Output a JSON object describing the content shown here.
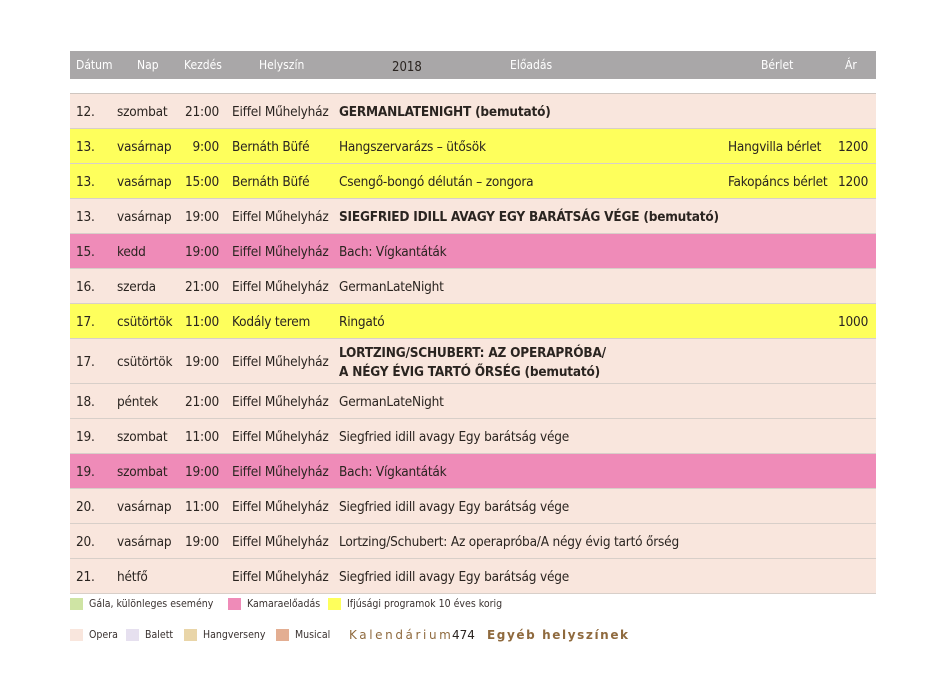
{
  "header": {
    "date": "Dátum",
    "day": "Nap",
    "start": "Kezdés",
    "venue": "Helyszín",
    "year": "2018",
    "show": "Előadás",
    "pass": "Bérlet",
    "price": "Ár"
  },
  "rows": [
    {
      "date": "12.",
      "day": "szombat",
      "time": "21:00",
      "venue": "Eiffel Műhelyház",
      "show": "GERMANLATENIGHT (bemutató)",
      "bold": true,
      "pass": "",
      "price": "",
      "category": "opera"
    },
    {
      "date": "13.",
      "day": "vasárnap",
      "time": "9:00",
      "venue": "Bernáth Büfé",
      "show": "Hangszervarázs – ütősök",
      "bold": false,
      "pass": "Hangvilla bérlet",
      "price": "1200",
      "category": "youth"
    },
    {
      "date": "13.",
      "day": "vasárnap",
      "time": "15:00",
      "venue": "Bernáth Büfé",
      "show": "Csengő-bongó délután – zongora",
      "bold": false,
      "pass": "Fakopáncs bérlet",
      "price": "1200",
      "category": "youth"
    },
    {
      "date": "13.",
      "day": "vasárnap",
      "time": "19:00",
      "venue": "Eiffel Műhelyház",
      "show": "SIEGFRIED IDILL AVAGY EGY BARÁTSÁG VÉGE (bemutató)",
      "bold": true,
      "pass": "",
      "price": "",
      "category": "opera"
    },
    {
      "date": "15.",
      "day": "kedd",
      "time": "19:00",
      "venue": "Eiffel Műhelyház",
      "show": "Bach: Vígkantáták",
      "bold": false,
      "pass": "",
      "price": "",
      "category": "chamber"
    },
    {
      "date": "16.",
      "day": "szerda",
      "time": "21:00",
      "venue": "Eiffel Műhelyház",
      "show": "GermanLateNight",
      "bold": false,
      "pass": "",
      "price": "",
      "category": "opera"
    },
    {
      "date": "17.",
      "day": "csütörtök",
      "time": "11:00",
      "venue": "Kodály terem",
      "show": "Ringató",
      "bold": false,
      "pass": "",
      "price": "1000",
      "category": "youth"
    },
    {
      "date": "17.",
      "day": "csütörtök",
      "time": "19:00",
      "venue": "Eiffel Műhelyház",
      "show": "LORTZING/SCHUBERT: AZ OPERAPRÓBA/\nA NÉGY ÉVIG TARTÓ ŐRSÉG (bemutató)",
      "bold": true,
      "pass": "",
      "price": "",
      "category": "opera",
      "tall": true
    },
    {
      "date": "18.",
      "day": "péntek",
      "time": "21:00",
      "venue": "Eiffel Műhelyház",
      "show": "GermanLateNight",
      "bold": false,
      "pass": "",
      "price": "",
      "category": "opera"
    },
    {
      "date": "19.",
      "day": "szombat",
      "time": "11:00",
      "venue": "Eiffel Műhelyház",
      "show": "Siegfried idill avagy Egy barátság vége",
      "bold": false,
      "pass": "",
      "price": "",
      "category": "opera"
    },
    {
      "date": "19.",
      "day": "szombat",
      "time": "19:00",
      "venue": "Eiffel Műhelyház",
      "show": "Bach: Vígkantáták",
      "bold": false,
      "pass": "",
      "price": "",
      "category": "chamber"
    },
    {
      "date": "20.",
      "day": "vasárnap",
      "time": "11:00",
      "venue": "Eiffel Műhelyház",
      "show": "Siegfried idill avagy Egy barátság vége",
      "bold": false,
      "pass": "",
      "price": "",
      "category": "opera"
    },
    {
      "date": "20.",
      "day": "vasárnap",
      "time": "19:00",
      "venue": "Eiffel Műhelyház",
      "show": "Lortzing/Schubert: Az operapróba/A négy évig tartó őrség",
      "bold": false,
      "pass": "",
      "price": "",
      "category": "opera"
    },
    {
      "date": "21.",
      "day": "hétfő",
      "time": "",
      "venue": "Eiffel Műhelyház",
      "show": "Siegfried idill avagy Egy barátság vége",
      "bold": false,
      "pass": "",
      "price": "",
      "category": "opera"
    }
  ],
  "legend_row1": [
    {
      "label": "Gála, különleges esemény",
      "color": "#cfe4a4"
    },
    {
      "label": "Kamaraelőadás",
      "color": "#ef8bb8"
    },
    {
      "label": "Ifjúsági programok 10 éves korig",
      "color": "#feff5c"
    }
  ],
  "legend_row2": [
    {
      "label": "Opera",
      "color": "#f9e6dd"
    },
    {
      "label": "Balett",
      "color": "#e6e0ef"
    },
    {
      "label": "Hangverseny",
      "color": "#e9d5a8"
    },
    {
      "label": "Musical",
      "color": "#e3ae92"
    }
  ],
  "footer": {
    "title": "Kalendárium",
    "page": "474",
    "section": "Egyéb helyszínek"
  }
}
